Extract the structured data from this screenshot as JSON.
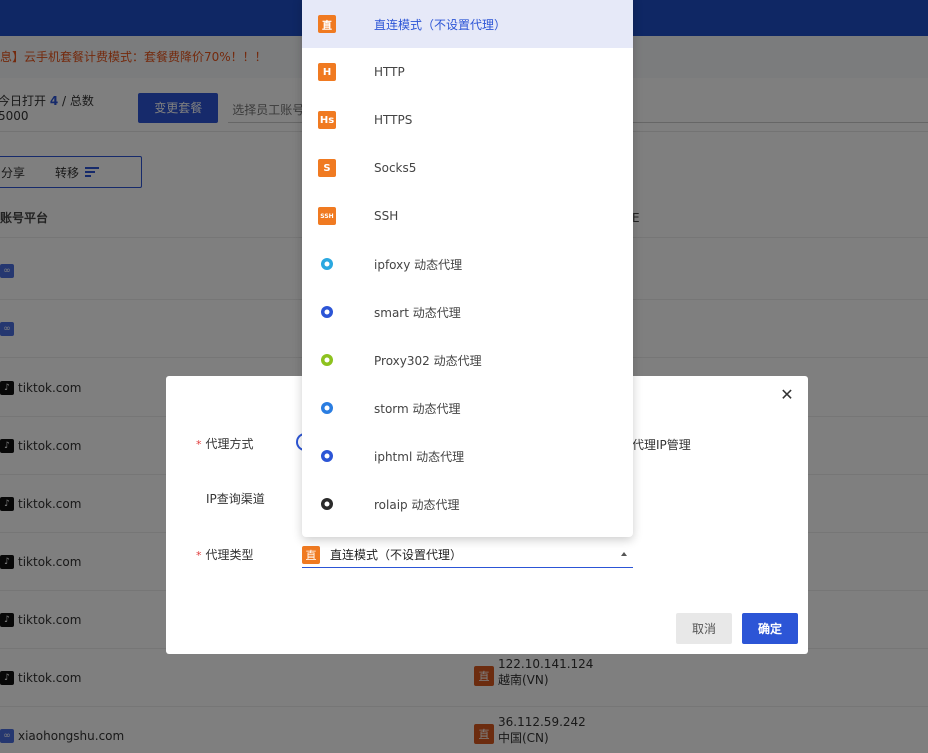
{
  "notice": "息】云手机套餐计费模式：套餐费降价70%！！！",
  "infobar": {
    "today_prefix": "今日打开",
    "today_count": "4",
    "total_text": "/ 总数 5000",
    "change_plan_label": "变更套餐",
    "staff_placeholder": "选择员工账号"
  },
  "toolbar": {
    "share_label": "分享",
    "transfer_label": "转移"
  },
  "table": {
    "col_platform": "账号平台",
    "col_right_fragment": "E",
    "rows": [
      {
        "icon": "link-icon",
        "platform": ""
      },
      {
        "icon": "link-icon",
        "platform": ""
      },
      {
        "icon": "tiktok-icon",
        "platform": "tiktok.com"
      },
      {
        "icon": "tiktok-icon",
        "platform": "tiktok.com"
      },
      {
        "icon": "tiktok-icon",
        "platform": "tiktok.com"
      },
      {
        "icon": "tiktok-icon",
        "platform": "tiktok.com"
      },
      {
        "icon": "tiktok-icon",
        "platform": "tiktok.com"
      },
      {
        "icon": "tiktok-icon",
        "platform": "tiktok.com"
      },
      {
        "icon": "link-icon",
        "platform": "xiaohongshu.com"
      }
    ],
    "ip_cells": [
      {
        "badge": "直",
        "ip": "122.10.141.124",
        "region": "越南(VN)"
      },
      {
        "badge": "直",
        "ip": "36.112.59.242",
        "region": "中国(CN)"
      }
    ]
  },
  "dialog": {
    "proxy_method_label": "代理方式",
    "ip_channel_label": "IP查询渠道",
    "proxy_type_label": "代理类型",
    "ip_mgmt_fragment": "代理IP管理",
    "selected_badge": "直",
    "selected_value": "直连模式（不设置代理）",
    "cancel_label": "取消",
    "ok_label": "确定",
    "close_glyph": "✕"
  },
  "dropdown": {
    "options": [
      {
        "label": "直连模式（不设置代理）",
        "badge": "直",
        "icon": "direct-icon",
        "color": "#f07a21",
        "selected": true
      },
      {
        "label": "HTTP",
        "badge": "H",
        "icon": "http-icon",
        "color": "#f07a21"
      },
      {
        "label": "HTTPS",
        "badge": "Hs",
        "icon": "https-icon",
        "color": "#f07a21"
      },
      {
        "label": "Socks5",
        "badge": "S",
        "icon": "socks5-icon",
        "color": "#f07a21"
      },
      {
        "label": "SSH",
        "badge": "SSH",
        "icon": "ssh-icon",
        "color": "#f07a21"
      },
      {
        "label": "ipfoxy 动态代理",
        "badge": "",
        "icon": "ipfoxy-icon",
        "color": "#2aa8e0"
      },
      {
        "label": "smart 动态代理",
        "badge": "",
        "icon": "smart-icon",
        "color": "#2c55d6"
      },
      {
        "label": "Proxy302 动态代理",
        "badge": "",
        "icon": "proxy302-icon",
        "color": "#8dc21f"
      },
      {
        "label": "storm 动态代理",
        "badge": "",
        "icon": "storm-icon",
        "color": "#2a7de1"
      },
      {
        "label": "iphtml 动态代理",
        "badge": "",
        "icon": "iphtml-icon",
        "color": "#2c55d6"
      },
      {
        "label": "rolaip 动态代理",
        "badge": "",
        "icon": "rolaip-icon",
        "color": "#2a2a2a"
      }
    ]
  }
}
